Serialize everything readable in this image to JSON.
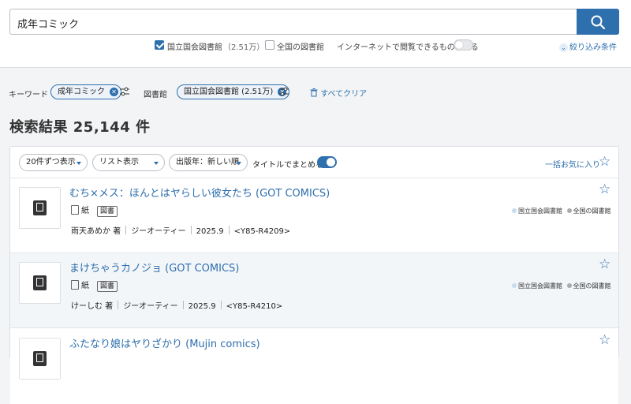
{
  "search": {
    "query": "成年コミック"
  },
  "filters": {
    "ndl_label": "国立国会図書館",
    "ndl_count": "（2.51万）",
    "national_label": "全国の図書館",
    "internet_label": "インターネットで閲覧できるものに絞る",
    "narrow_label": "絞り込み条件"
  },
  "conditions": {
    "keyword_label": "キーワード",
    "keyword_chip": "成年コミック",
    "library_label": "図書館",
    "library_chip": "国立国会図書館 (2.51万)",
    "clear_label": "すべてクリア"
  },
  "results": {
    "title": "検索結果 25,144 件"
  },
  "toolbar": {
    "per_page": "20件ずつ表示",
    "view": "リスト表示",
    "sort": "出版年：新しい順",
    "group_label": "タイトルでまとめる",
    "fav_all": "一括お気に入り"
  },
  "items": [
    {
      "title": "むち×メス：ほんとはヤらしい彼女たち (GOT COMICS)",
      "medium": "紙",
      "type": "図書",
      "author": "雨天あめか 著",
      "publisher": "ジーオーティー",
      "year": "2025.9",
      "callno": "<Y85-R4209>",
      "holding1": "国立国会図書館",
      "holding2": "全国の図書館"
    },
    {
      "title": "まけちゃうカノジョ (GOT COMICS)",
      "medium": "紙",
      "type": "図書",
      "author": "けーしむ 著",
      "publisher": "ジーオーティー",
      "year": "2025.9",
      "callno": "<Y85-R4210>",
      "holding1": "国立国会図書館",
      "holding2": "全国の図書館"
    },
    {
      "title": "ふたなり娘はヤりざかり (Mujin comics)"
    }
  ],
  "colors": {
    "accent": "#2e6fad",
    "alt_row": "#f3f6f9"
  }
}
